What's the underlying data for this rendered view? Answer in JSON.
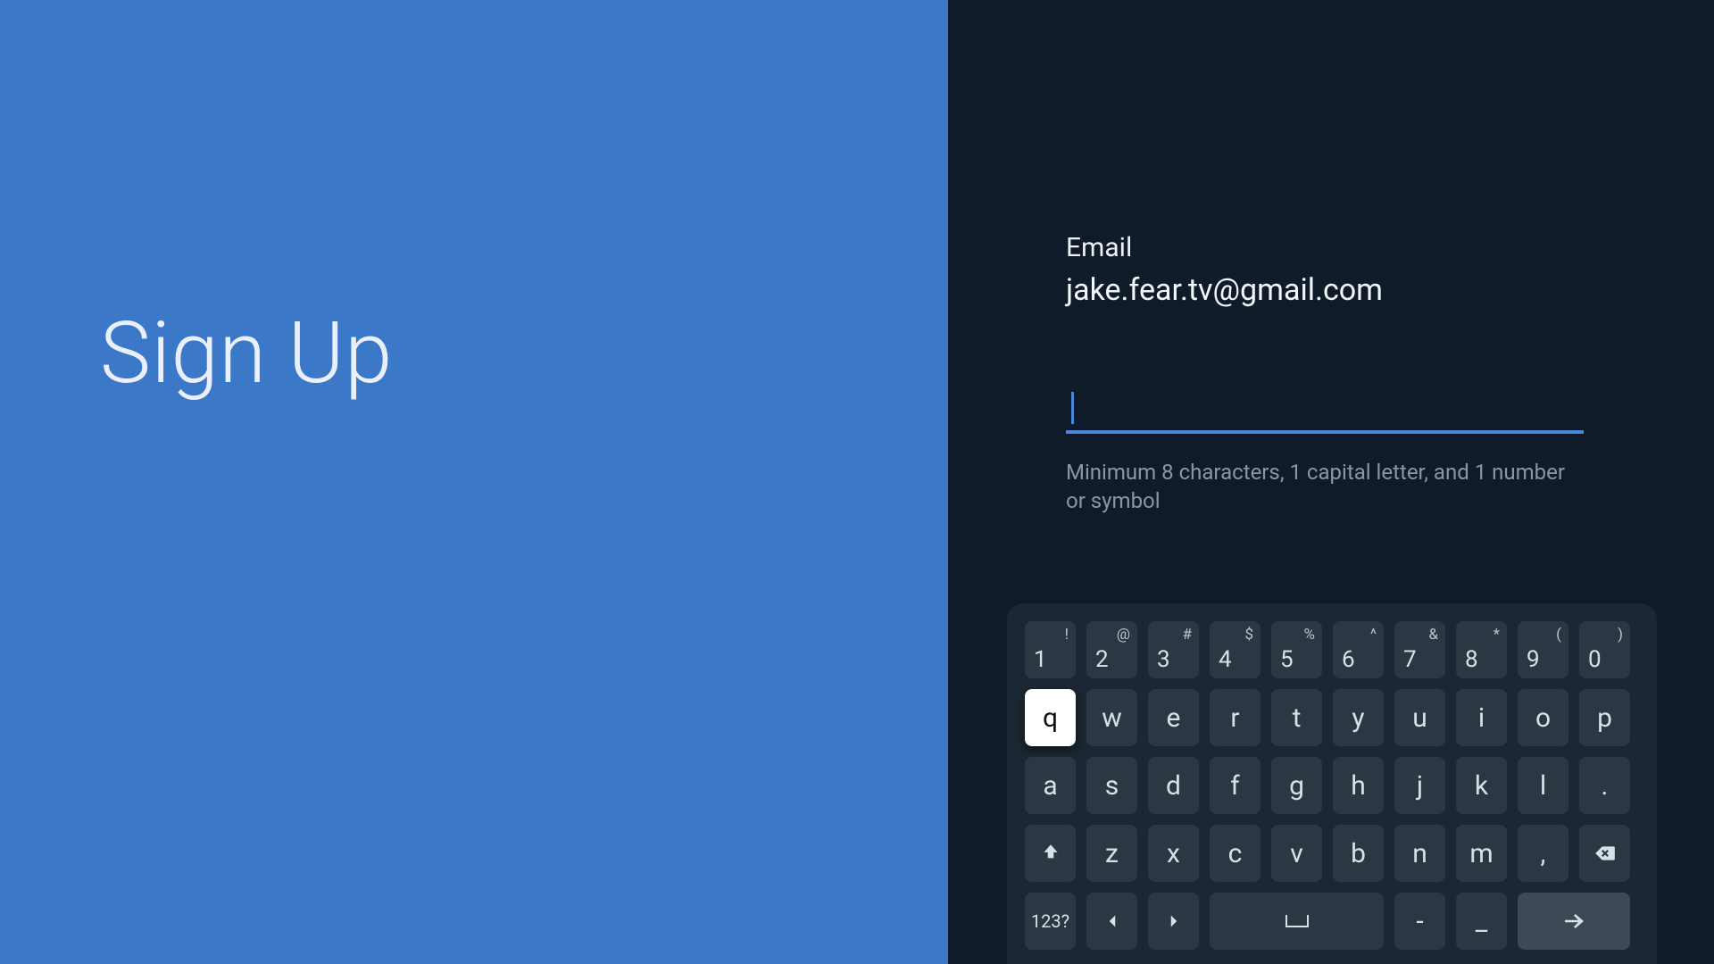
{
  "left": {
    "title": "Sign Up"
  },
  "form": {
    "email_label": "Email",
    "email_value": "jake.fear.tv@gmail.com",
    "password_value": "",
    "password_hint": "Minimum 8 characters, 1 capital letter, and 1 number or symbol"
  },
  "keyboard": {
    "row1": [
      {
        "main": "1",
        "sup": "!"
      },
      {
        "main": "2",
        "sup": "@"
      },
      {
        "main": "3",
        "sup": "#"
      },
      {
        "main": "4",
        "sup": "$"
      },
      {
        "main": "5",
        "sup": "%"
      },
      {
        "main": "6",
        "sup": "^"
      },
      {
        "main": "7",
        "sup": "&"
      },
      {
        "main": "8",
        "sup": "*"
      },
      {
        "main": "9",
        "sup": "("
      },
      {
        "main": "0",
        "sup": ")"
      }
    ],
    "row2": [
      "q",
      "w",
      "e",
      "r",
      "t",
      "y",
      "u",
      "i",
      "o",
      "p"
    ],
    "row2_focused_index": 0,
    "row3": [
      "a",
      "s",
      "d",
      "f",
      "g",
      "h",
      "j",
      "k",
      "l",
      "."
    ],
    "row4_letters": [
      "z",
      "x",
      "c",
      "v",
      "b",
      "n",
      "m",
      ","
    ],
    "row5": {
      "symbols_label": "123?",
      "dash": "-",
      "underscore": "_"
    },
    "icons": {
      "shift": "shift-icon",
      "backspace": "backspace-icon",
      "left": "arrow-left-icon",
      "right": "arrow-right-icon",
      "space": "space-icon",
      "enter": "arrow-enter-icon"
    }
  },
  "colors": {
    "left_bg": "#3c78c8",
    "right_bg": "#0f1b29",
    "accent": "#4a86d9",
    "key_bg": "#2b3742",
    "keyboard_bg": "#1b2732"
  }
}
